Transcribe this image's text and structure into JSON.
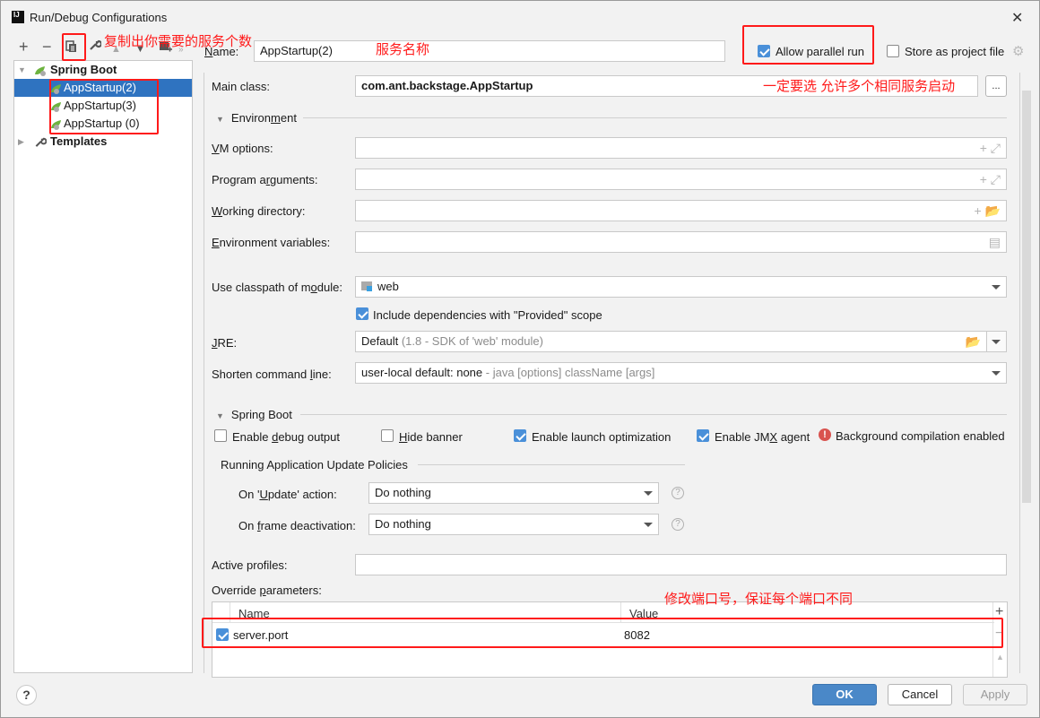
{
  "window": {
    "title": "Run/Debug Configurations",
    "app_icon": "IJ"
  },
  "toolbar": {
    "icons": [
      "plus-icon",
      "minus-icon",
      "copy-icon",
      "wrench-icon",
      "move-up-icon",
      "move-down-icon",
      "new-folder-icon",
      "more-icon"
    ]
  },
  "tree": {
    "group": "Spring Boot",
    "items": [
      {
        "label": "AppStartup(2)",
        "selected": true
      },
      {
        "label": "AppStartup(3)",
        "selected": false
      },
      {
        "label": "AppStartup (0)",
        "selected": false
      }
    ],
    "templates": "Templates"
  },
  "header": {
    "name_label": "Name:",
    "name_value": "AppStartup(2)",
    "allow_parallel_label": "Allow parallel run",
    "allow_parallel_checked": true,
    "store_label": "Store as project file",
    "store_checked": false
  },
  "form": {
    "main_class_label": "Main class:",
    "main_class_value": "com.ant.backstage.AppStartup",
    "browse_label": "...",
    "environment_section": "Environment",
    "vm_options_label": "VM options:",
    "vm_options_value": "",
    "program_args_label": "Program arguments:",
    "program_args_value": "",
    "working_dir_label": "Working directory:",
    "working_dir_value": "",
    "env_vars_label": "Environment variables:",
    "env_vars_value": "",
    "classpath_label": "Use classpath of module:",
    "classpath_value": "web",
    "include_deps_label": "Include dependencies with \"Provided\" scope",
    "include_deps_checked": true,
    "jre_label": "JRE:",
    "jre_value": "Default",
    "jre_hint": "(1.8 - SDK of 'web' module)",
    "shorten_label": "Shorten command line:",
    "shorten_value": "user-local default: none",
    "shorten_hint": "- java [options] className [args]"
  },
  "spring_boot": {
    "section": "Spring Boot",
    "debug_output_label": "Enable debug output",
    "debug_output_checked": false,
    "hide_banner_label": "Hide banner",
    "hide_banner_checked": false,
    "launch_opt_label": "Enable launch optimization",
    "launch_opt_checked": true,
    "jmx_label": "Enable JMX agent",
    "jmx_checked": true,
    "bg_compilation_label": "Background compilation enabled",
    "policies_title": "Running Application Update Policies",
    "update_action_label": "On 'Update' action:",
    "update_action_value": "Do nothing",
    "frame_deact_label": "On frame deactivation:",
    "frame_deact_value": "Do nothing",
    "active_profiles_label": "Active profiles:",
    "active_profiles_value": "",
    "override_label": "Override parameters:",
    "table": {
      "columns": [
        "Name",
        "Value"
      ],
      "rows": [
        {
          "enabled": true,
          "name": "server.port",
          "value": "8082"
        }
      ]
    }
  },
  "buttons": {
    "ok": "OK",
    "cancel": "Cancel",
    "apply": "Apply",
    "help": "?"
  },
  "annotations": {
    "copy_note": "复制出你需要的服务个数",
    "name_note": "服务名称",
    "parallel_note": "一定要选 允许多个相同服务启动",
    "port_note": "修改端口号，保证每个端口不同",
    "color": "#ff1a1a"
  }
}
